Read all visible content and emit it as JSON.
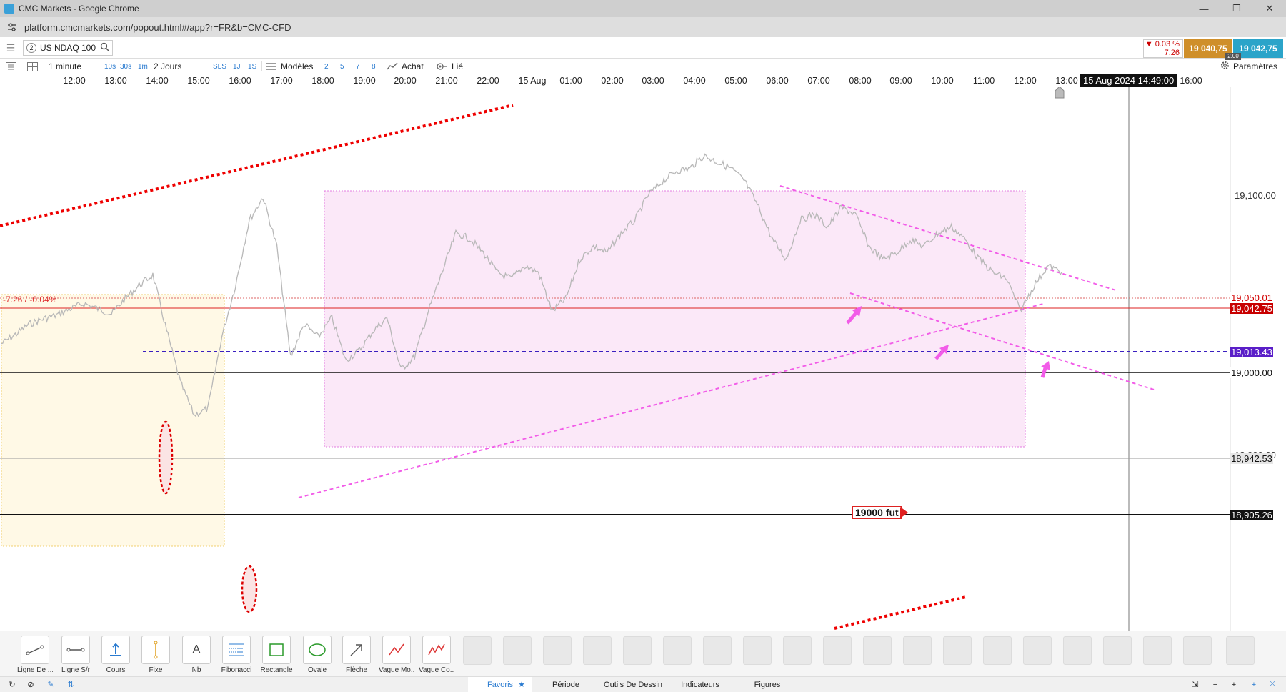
{
  "window": {
    "title": "CMC Markets - Google Chrome",
    "minimize": "—",
    "restore": "❐",
    "close": "✕"
  },
  "browser": {
    "url": "platform.cmcmarkets.com/popout.html#/app?r=FR&b=CMC-CFD",
    "site_icon": "tune-icon"
  },
  "header": {
    "instrument_number": "2",
    "instrument": "US NDAQ 100",
    "change_pct": "▼ 0.03 %",
    "change_abs": "7.26",
    "sell_price": "19 040,75",
    "buy_price": "19 042,75",
    "spread": "2.00",
    "colors": {
      "sell": "#cf8f2a",
      "buy": "#2ba4c9",
      "down": "#cc0000"
    }
  },
  "toolbar": {
    "interval": "1 minute",
    "intervals": [
      "10s",
      "30s",
      "1m"
    ],
    "range": "2 Jours",
    "ranges": [
      "SLS",
      "1J",
      "1S"
    ],
    "templates": "Modèles",
    "layouts": [
      "2",
      "5",
      "7",
      "8"
    ],
    "price_type": "Achat",
    "linked": "Lié",
    "settings": "Paramètres"
  },
  "time_axis": {
    "labels": [
      "12:00",
      "13:00",
      "14:00",
      "15:00",
      "16:00",
      "17:00",
      "18:00",
      "19:00",
      "20:00",
      "21:00",
      "22:00",
      "15 Aug",
      "01:00",
      "02:00",
      "03:00",
      "04:00",
      "05:00",
      "06:00",
      "07:00",
      "08:00",
      "09:00",
      "10:00",
      "11:00",
      "12:00",
      "13:00",
      "16:00"
    ],
    "crosshair_date": "15 Aug 2024 14:49:00"
  },
  "chart": {
    "change_label": "-7.26 / -0.04%",
    "fut_label": "19000 fut",
    "price_labels": [
      {
        "text": "19,050.01",
        "color": "#d20000",
        "bg": "#ffffff"
      },
      {
        "text": "19,042.75",
        "color": "#ffffff",
        "bg": "#c80000"
      },
      {
        "text": "19,013.43",
        "color": "#ffffff",
        "bg": "#5a1ec8"
      },
      {
        "text": "19,000.00",
        "color": "#111111",
        "bg": "#ffffff"
      },
      {
        "text": "18,942.53",
        "color": "#111111",
        "bg": "#e6e6e6"
      },
      {
        "text": "18,905.26",
        "color": "#ffffff",
        "bg": "#111111"
      }
    ],
    "grid_labels": [
      "19,100.00",
      "18,900.00"
    ]
  },
  "chart_data": {
    "type": "line",
    "title": "US NDAQ 100",
    "interval": "1 minute",
    "x_labels": [
      "12:00",
      "13:00",
      "14:00",
      "15:00",
      "16:00",
      "17:00",
      "18:00",
      "19:00",
      "20:00",
      "21:00",
      "22:00",
      "15 Aug",
      "01:00",
      "02:00",
      "03:00",
      "04:00",
      "05:00",
      "06:00",
      "07:00",
      "08:00",
      "09:00",
      "10:00",
      "11:00",
      "12:00",
      "13:00"
    ],
    "series": [
      {
        "values": [
          18985,
          18992,
          19000,
          19004,
          19007,
          19012,
          19016,
          19012,
          19008,
          19020,
          19030,
          19038,
          18995,
          18955,
          18930,
          18935,
          18990,
          19030,
          19080,
          19098,
          19060,
          18975,
          19000,
          18990,
          19005,
          18972,
          18980,
          18995,
          19005,
          18965,
          18975,
          19010,
          19040,
          19070,
          19066,
          19055,
          19040,
          19035,
          19045,
          19040,
          19010,
          19020,
          19050,
          19060,
          19055,
          19070,
          19080,
          19100,
          19110,
          19118,
          19120,
          19130,
          19125,
          19120,
          19110,
          19090,
          19065,
          19050,
          19080,
          19085,
          19075,
          19090,
          19085,
          19060,
          19050,
          19055,
          19065,
          19060,
          19070,
          19075,
          19065,
          19050,
          19040,
          19035,
          19010,
          19030,
          19045,
          19040
        ]
      }
    ],
    "price_levels": [
      19100,
      19050.01,
      19042.75,
      19013.43,
      19000,
      18942.53,
      18905.26,
      18900
    ],
    "y_range": [
      18880,
      19120
    ]
  },
  "tools": [
    {
      "label": "Ligne De ...",
      "icon": "trend-line-icon"
    },
    {
      "label": "Ligne S/r",
      "icon": "horizontal-line-icon"
    },
    {
      "label": "Cours",
      "icon": "price-marker-icon"
    },
    {
      "label": "Fixe",
      "icon": "vertical-line-icon"
    },
    {
      "label": "Nb",
      "icon": "text-note-icon"
    },
    {
      "label": "Fibonacci",
      "icon": "fibonacci-icon"
    },
    {
      "label": "Rectangle",
      "icon": "rectangle-icon"
    },
    {
      "label": "Ovale",
      "icon": "oval-icon"
    },
    {
      "label": "Flèche",
      "icon": "arrow-icon"
    },
    {
      "label": "Vague Mo...",
      "icon": "wave-motive-icon"
    },
    {
      "label": "Vague Co...",
      "icon": "wave-corrective-icon"
    }
  ],
  "bottom_tabs": [
    "Favoris",
    "Période",
    "Outils De Dessin",
    "Indicateurs",
    "Figures"
  ]
}
